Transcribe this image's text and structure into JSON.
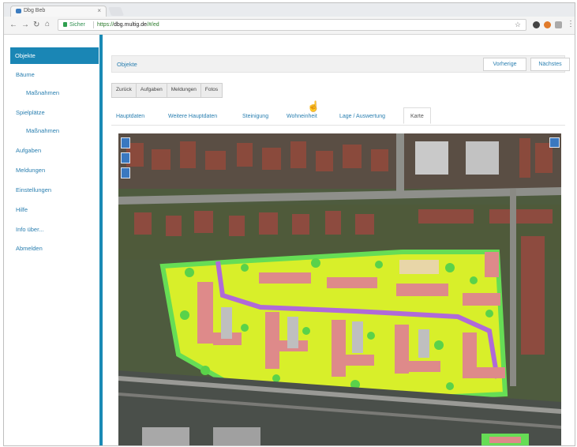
{
  "browser": {
    "tab_title": "Dbg Beb",
    "tab_close": "×",
    "security_label": "Sicher",
    "url_prefix": "https://",
    "url_domain": "dbg.multig.de",
    "url_path": "/#/ed",
    "star": "☆"
  },
  "sidebar": {
    "items": [
      {
        "label": "Objekte",
        "active": true
      },
      {
        "label": "Bäume"
      },
      {
        "label": "Maßnahmen"
      },
      {
        "label": "Spielplätze"
      },
      {
        "label": "Maßnahmen"
      },
      {
        "label": "Aufgaben"
      },
      {
        "label": "Meldungen"
      },
      {
        "label": "Einstellungen"
      },
      {
        "label": "Hilfe"
      },
      {
        "label": "Info über..."
      },
      {
        "label": "Abmelden"
      }
    ]
  },
  "main": {
    "header_title": "Objekte",
    "buttons": {
      "back": "Vorherige",
      "next": "Nächstes"
    },
    "segments": [
      "Zurück",
      "Aufgaben",
      "Meldungen",
      "Fotos"
    ],
    "tabs": [
      "Hauptdaten",
      "Weitere Hauptdaten",
      "Steinigung",
      "Wohneinheit",
      "Lage / Auswertung",
      "Karte"
    ],
    "selected_tab": "Karte"
  },
  "colors": {
    "accent": "#1a86b5",
    "link": "#2a7fb0",
    "hedge_green": "#66dd55",
    "lawn_yellow": "#d8ef2a",
    "building_pink": "#de8a8a",
    "path_purple": "#b06ad8"
  },
  "icons": {
    "cursor": "hand-pointer-icon",
    "lock": "lock-icon",
    "star": "star-icon"
  }
}
